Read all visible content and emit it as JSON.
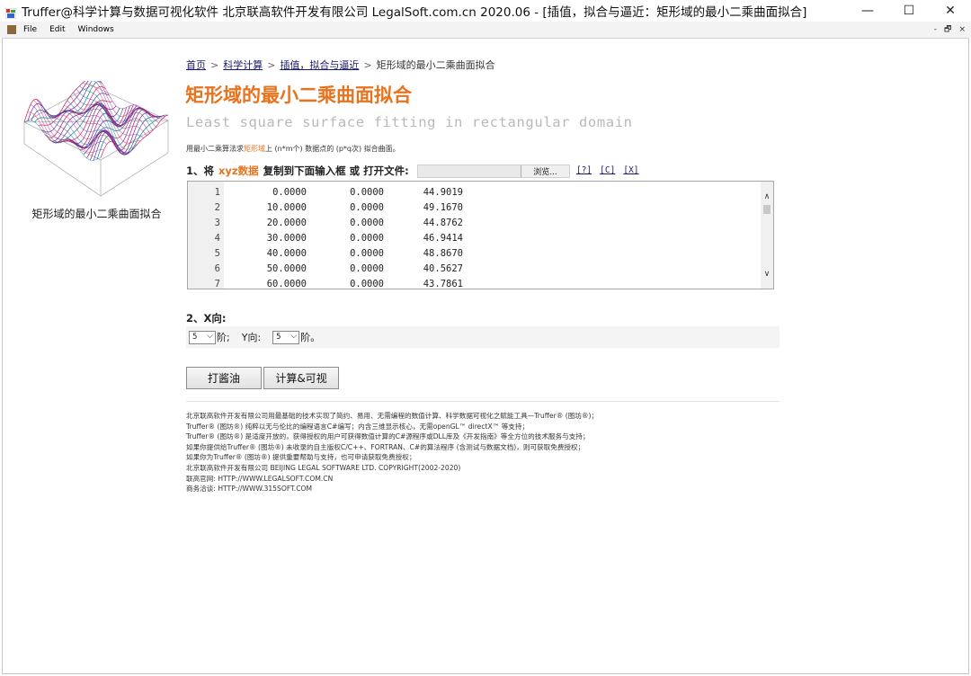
{
  "window": {
    "title": "Truffer@科学计算与数据可视化软件 北京联高软件开发有限公司 LegalSoft.com.cn 2020.06 - [插值，拟合与逼近：矩形域的最小二乘曲面拟合]",
    "controls": {
      "minimize": "—",
      "maximize": "☐",
      "close": "✕"
    }
  },
  "menubar": {
    "items": [
      "File",
      "Edit",
      "Windows"
    ],
    "mdi_controls": [
      "-",
      "🗗",
      "×"
    ]
  },
  "sidebar": {
    "caption": "矩形域的最小二乘曲面拟合",
    "thumbnail_icon": "surface-plot-icon"
  },
  "breadcrumb": {
    "items": [
      "首页",
      "科学计算",
      "插值，拟合与逼近"
    ],
    "current": "矩形域的最小二乘曲面拟合",
    "separator": ">"
  },
  "page": {
    "title": "矩形域的最小二乘曲面拟合",
    "subtitle": "Least square surface fitting in rectangular domain",
    "desc_before": "用最小二乘算法求",
    "desc_highlight": "矩形域",
    "desc_after": "上 (n*m个) 数据点的 (p*q次) 拟合曲面。",
    "accent_color": "#e8731e"
  },
  "step1": {
    "prefix": "1、将",
    "xyz": "xyz数据",
    "suffix": "复制到下面输入框 或 打开文件:",
    "browse_label": "浏览...",
    "links": [
      "[?]",
      "[C]",
      "[X]"
    ]
  },
  "editor": {
    "rows": [
      [
        "1",
        "0.0000",
        "0.0000",
        "44.9019"
      ],
      [
        "2",
        "10.0000",
        "0.0000",
        "49.1670"
      ],
      [
        "3",
        "20.0000",
        "0.0000",
        "44.8762"
      ],
      [
        "4",
        "30.0000",
        "0.0000",
        "46.9414"
      ],
      [
        "5",
        "40.0000",
        "0.0000",
        "48.8670"
      ],
      [
        "6",
        "50.0000",
        "0.0000",
        "40.5627"
      ],
      [
        "7",
        "60.0000",
        "0.0000",
        "43.7861"
      ]
    ]
  },
  "step2": {
    "label": "2、X向:",
    "x_order": "5",
    "x_unit": "阶;",
    "y_label": "Y向:",
    "y_order": "5",
    "y_unit": "阶。"
  },
  "buttons": {
    "first": "打酱油",
    "second": "计算&可视"
  },
  "footer": {
    "lines": [
      "北京联高软件开发有限公司用最基础的技术实现了简约、易用、无需编程的数值计算、科学数据可视化之赋能工具—Truffer® (图坊®)；",
      "Truffer® (图坊®) 纯粹以无与伦比的编程语言C#编写；内含三维显示核心，无需openGL™ directX™ 等支持；",
      "Truffer® (图坊®) 是适度开放的，获得授权的用户可获得数值计算的C#源程序或DLL库及《开发指南》等全方位的技术服务与支持；",
      "如果你提供给Truffer® (图坊®) 未收录的自主版权C/C++、FORTRAN、C#的算法程序 (含测试与数据文档)，则可获取免费授权；",
      "如果你为Truffer® (图坊®) 提供重要帮助与支持，也可申请获取免费授权；",
      "北京联高软件开发有限公司 BEIJING LEGAL SOFTWARE LTD. COPYRIGHT(2002-2020)",
      "联高官网: HTTP://WWW.LEGALSOFT.COM.CN",
      "商务洽谈: HTTP://WWW.315SOFT.COM"
    ]
  }
}
